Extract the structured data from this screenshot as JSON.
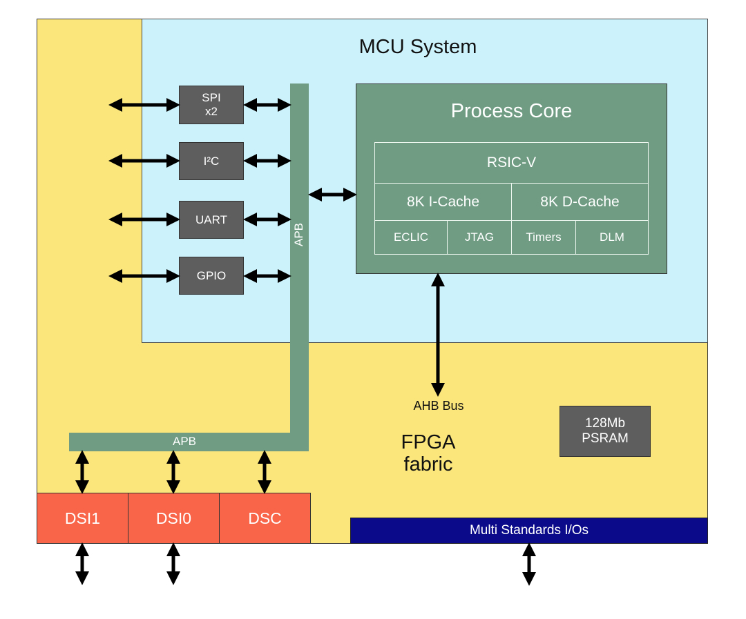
{
  "title": "MCU System",
  "fpga": {
    "line1": "FPGA",
    "line2": "fabric"
  },
  "peripherals": [
    {
      "id": "spi",
      "line1": "SPI",
      "line2": "x2"
    },
    {
      "id": "i2c",
      "line1": "I²C",
      "line2": ""
    },
    {
      "id": "uart",
      "line1": "UART",
      "line2": ""
    },
    {
      "id": "gpio",
      "line1": "GPIO",
      "line2": ""
    }
  ],
  "apb_vertical_label": "APB",
  "apb_horizontal_label": "APB",
  "process_core": {
    "title": "Process Core",
    "cpu": "RSIC-V",
    "icache": "8K I-Cache",
    "dcache": "8K D-Cache",
    "eclic": "ECLIC",
    "jtag": "JTAG",
    "timers": "Timers",
    "dlm": "DLM"
  },
  "ahb_bus_label": "AHB Bus",
  "psram": {
    "line1": "128Mb",
    "line2": "PSRAM"
  },
  "display_blocks": [
    "DSI1",
    "DSI0",
    "DSC"
  ],
  "io_bar_label": "Multi Standards I/Os",
  "colors": {
    "fpga_fabric": "#fae67a",
    "mcu_system": "#ccf2fb",
    "bus_green": "#6f9c83",
    "peripheral_gray": "#5e5e5e",
    "dsi_orange": "#f86548",
    "io_blue": "#0a0a8a"
  }
}
